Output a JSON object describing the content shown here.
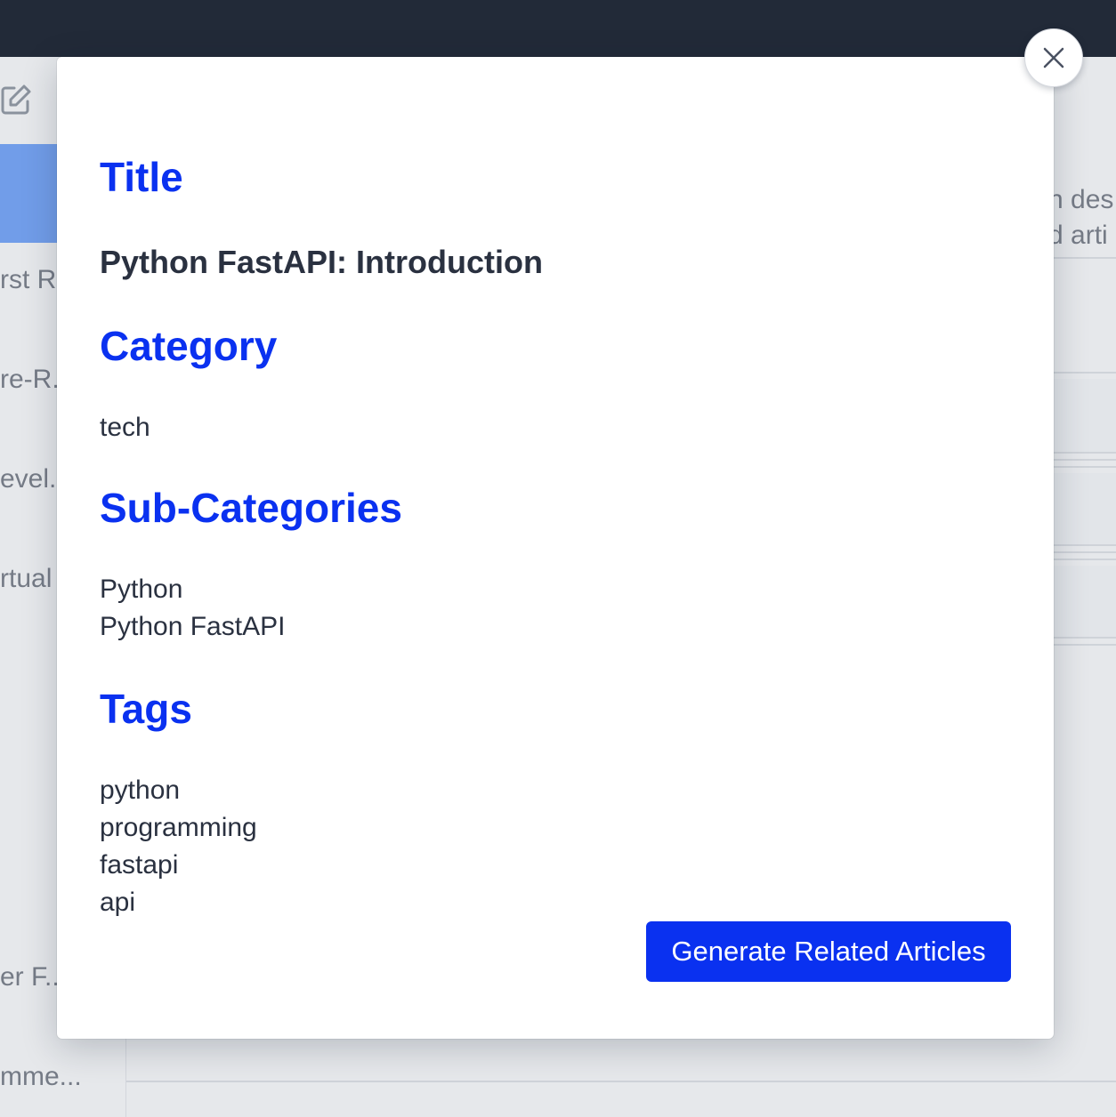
{
  "background": {
    "sidebar_items": [
      "rst R",
      "re-R...",
      "evel...",
      "rtual",
      "er F...",
      "mme..."
    ],
    "main_text": [
      "n des",
      "d arti"
    ]
  },
  "modal": {
    "sections": {
      "title": {
        "heading": "Title",
        "value": "Python FastAPI: Introduction"
      },
      "category": {
        "heading": "Category",
        "value": "tech"
      },
      "subcategories": {
        "heading": "Sub-Categories",
        "items": [
          "Python",
          "Python FastAPI"
        ]
      },
      "tags": {
        "heading": "Tags",
        "items": [
          "python",
          "programming",
          "fastapi",
          "api"
        ]
      }
    },
    "generate_button_label": "Generate Related Articles",
    "close_icon": "close-icon"
  },
  "colors": {
    "accent": "#0a31f0",
    "header": "#222a38",
    "sidebar_active": "#3476e8"
  }
}
